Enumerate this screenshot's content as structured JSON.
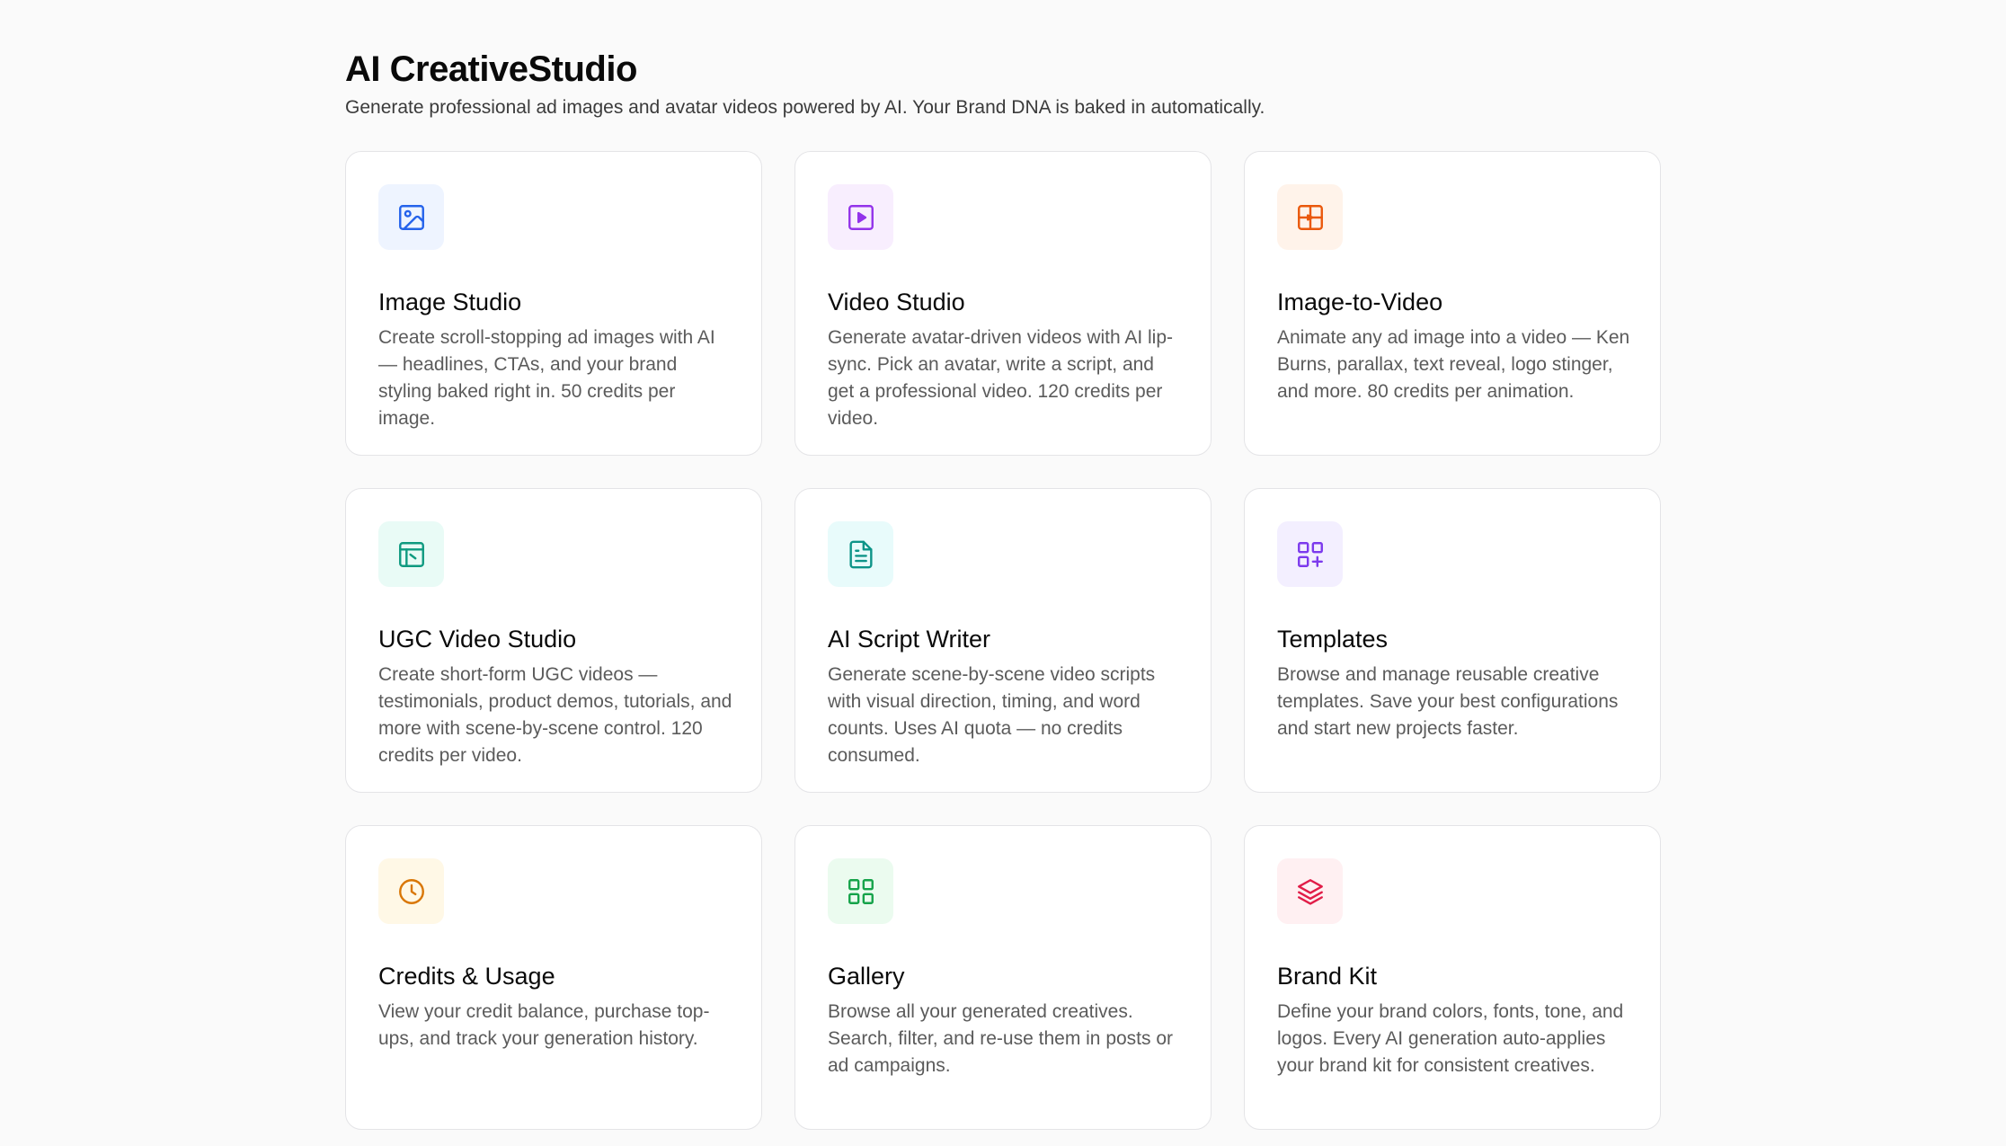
{
  "header": {
    "title": "AI CreativeStudio",
    "subtitle": "Generate professional ad images and avatar videos powered by AI. Your Brand DNA is baked in automatically."
  },
  "cards": [
    {
      "title": "Image Studio",
      "description": "Create scroll-stopping ad images with AI — headlines, CTAs, and your brand styling baked right in. 50 credits per image.",
      "icon": "image-icon",
      "icon_bg": "#eef4ff",
      "icon_color": "#2563eb"
    },
    {
      "title": "Video Studio",
      "description": "Generate avatar-driven videos with AI lip-sync. Pick an avatar, write a script, and get a professional video. 120 credits per video.",
      "icon": "play-icon",
      "icon_bg": "#f8eefe",
      "icon_color": "#9333ea"
    },
    {
      "title": "Image-to-Video",
      "description": "Animate any ad image into a video — Ken Burns, parallax, text reveal, logo stinger, and more. 80 credits per animation.",
      "icon": "film-icon",
      "icon_bg": "#fff3ea",
      "icon_color": "#ea580c"
    },
    {
      "title": "UGC Video Studio",
      "description": "Create short-form UGC videos — testimonials, product demos, tutorials, and more with scene-by-scene control. 120 credits per video.",
      "icon": "clapperboard-icon",
      "icon_bg": "#e9fbf6",
      "icon_color": "#0f9a80"
    },
    {
      "title": "AI Script Writer",
      "description": "Generate scene-by-scene video scripts with visual direction, timing, and word counts. Uses AI quota — no credits consumed.",
      "icon": "document-icon",
      "icon_bg": "#e8fbfb",
      "icon_color": "#0d9488"
    },
    {
      "title": "Templates",
      "description": "Browse and manage reusable creative templates. Save your best configurations and start new projects faster.",
      "icon": "add-grid-icon",
      "icon_bg": "#f3efff",
      "icon_color": "#7c3aed"
    },
    {
      "title": "Credits & Usage",
      "description": "View your credit balance, purchase top-ups, and track your generation history.",
      "icon": "clock-icon",
      "icon_bg": "#fff8e6",
      "icon_color": "#d97706"
    },
    {
      "title": "Gallery",
      "description": "Browse all your generated creatives. Search, filter, and re-use them in posts or ad campaigns.",
      "icon": "grid-icon",
      "icon_bg": "#ebfbef",
      "icon_color": "#16a34a"
    },
    {
      "title": "Brand Kit",
      "description": "Define your brand colors, fonts, tone, and logos. Every AI generation auto-applies your brand kit for consistent creatives.",
      "icon": "layers-icon",
      "icon_bg": "#fff0f2",
      "icon_color": "#e11d48"
    }
  ]
}
